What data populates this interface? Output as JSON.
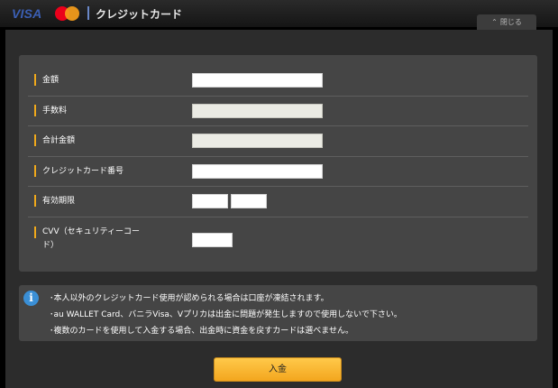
{
  "header": {
    "visa_logo_text": "VISA",
    "title": "クレジットカード",
    "close_label": "閉じる",
    "close_icon": "chevron-up-icon"
  },
  "form": {
    "rows": [
      {
        "label": "金額",
        "field": "amount",
        "readonly": false,
        "value": ""
      },
      {
        "label": "手数料",
        "field": "fee",
        "readonly": true,
        "value": ""
      },
      {
        "label": "合計金額",
        "field": "total",
        "readonly": true,
        "value": ""
      },
      {
        "label": "クレジットカード番号",
        "field": "card-number",
        "readonly": false,
        "value": ""
      },
      {
        "label": "有効期限",
        "field": "expiry",
        "readonly": false,
        "value": ""
      },
      {
        "label": "CVV（セキュリティーコー",
        "label2": "ド）",
        "field": "cvv",
        "readonly": false,
        "value": ""
      }
    ]
  },
  "notice": {
    "icon": "info-icon",
    "lines": [
      "･本人以外のクレジットカード使用が認められる場合は口座が凍結されます。",
      "･au WALLET Card、バニラVisa、Vプリカは出金に問題が発生しますので使用しないで下さい。",
      "･複数のカードを使用して入金する場合、出金時に資金を戻すカードは選べません。"
    ]
  },
  "submit_label": "入金",
  "colors": {
    "accent": "#f0a91b",
    "panel": "#454545",
    "info_blue": "#3a8fd6",
    "visa_blue": "#3b5fb4"
  }
}
